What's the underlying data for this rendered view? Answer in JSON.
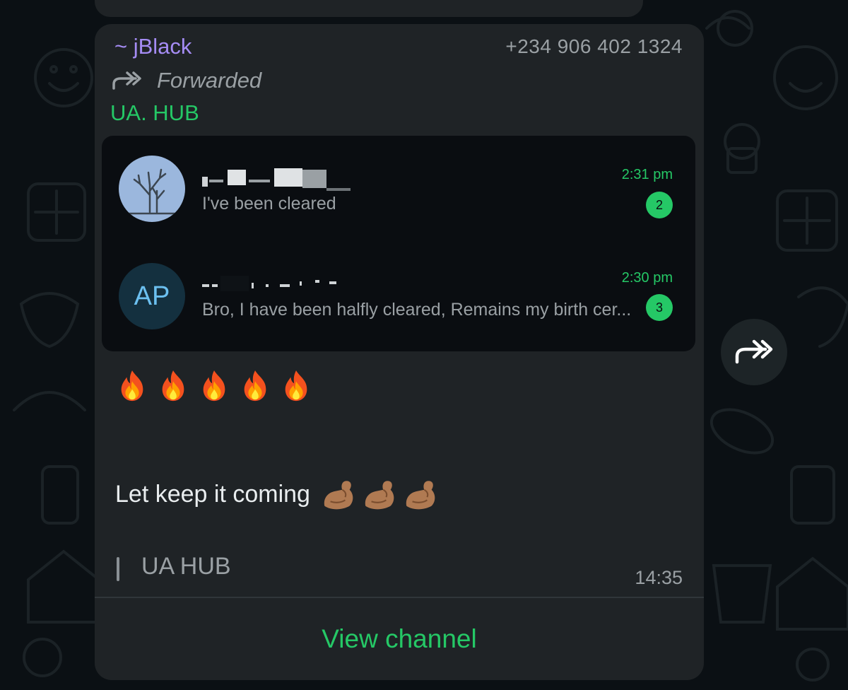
{
  "message": {
    "sender": "~ jBlack",
    "phone": "+234 906 402 1324",
    "forwarded_label": "Forwarded",
    "channel_name": "UA. HUB",
    "screenshot_chats": [
      {
        "preview": "I've been cleared",
        "time": "2:31 pm",
        "unread": "2",
        "avatar_icon": "tree-icon"
      },
      {
        "avatar_initials": "AP",
        "preview": "Bro, I have been halfly cleared, Remains my birth cer...",
        "time": "2:30 pm",
        "unread": "3"
      }
    ],
    "fire_emoji_count": 5,
    "text": "Let keep it coming",
    "flexed_biceps_count": 3,
    "signature": "UA HUB",
    "timestamp": "14:35",
    "view_channel_label": "View channel"
  },
  "colors": {
    "bubble": "#1f2326",
    "accent_green": "#25c866",
    "sender_purple": "#a58cf4",
    "muted_text": "#9aa0a4",
    "background": "#0b1014"
  }
}
